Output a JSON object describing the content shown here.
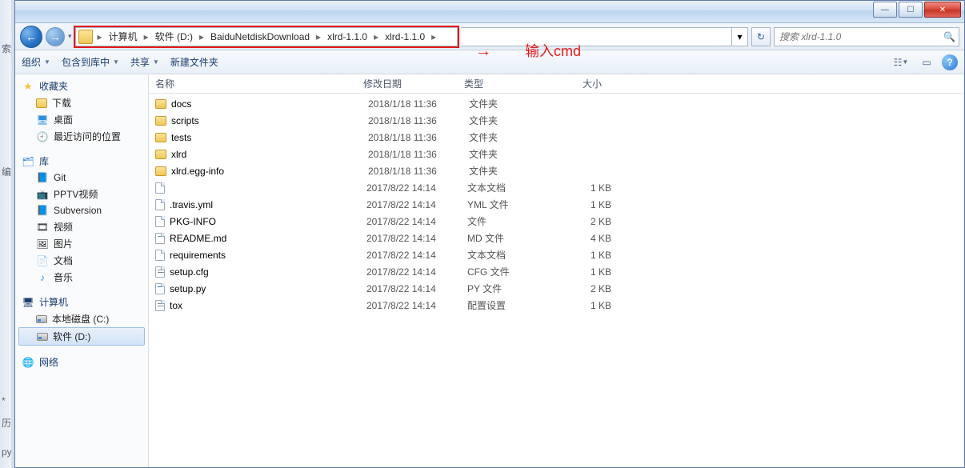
{
  "edge": {
    "t1": "索",
    "t2": "编",
    "t3": "*",
    "t4": "历",
    "t5": "py"
  },
  "titlebar": {
    "min": "—",
    "max": "☐",
    "close": "✕"
  },
  "nav": {
    "back": "←",
    "fwd": "→",
    "dropdown": "▾",
    "refresh": "↻"
  },
  "breadcrumb": {
    "items": [
      "计算机",
      "软件 (D:)",
      "BaiduNetdiskDownload",
      "xlrd-1.1.0",
      "xlrd-1.1.0"
    ],
    "sep": "▸"
  },
  "search": {
    "placeholder": "搜索 xlrd-1.1.0",
    "icon": "🔍"
  },
  "toolbar": {
    "organize": "组织",
    "include": "包含到库中",
    "share": "共享",
    "newfolder": "新建文件夹",
    "view_icon": "☷",
    "preview_icon": "▭",
    "arrow": "▼"
  },
  "sidebar": {
    "favorites": {
      "label": "收藏夹",
      "items": [
        {
          "icon": "download",
          "label": "下载"
        },
        {
          "icon": "desktop",
          "label": "桌面"
        },
        {
          "icon": "recent",
          "label": "最近访问的位置"
        }
      ]
    },
    "libraries": {
      "label": "库",
      "items": [
        {
          "icon": "git",
          "label": "Git"
        },
        {
          "icon": "pptv",
          "label": "PPTV视频"
        },
        {
          "icon": "svn",
          "label": "Subversion"
        },
        {
          "icon": "video",
          "label": "视频"
        },
        {
          "icon": "pic",
          "label": "图片"
        },
        {
          "icon": "doc",
          "label": "文档"
        },
        {
          "icon": "music",
          "label": "音乐"
        }
      ]
    },
    "computer": {
      "label": "计算机",
      "items": [
        {
          "icon": "drive-c",
          "label": "本地磁盘 (C:)"
        },
        {
          "icon": "drive-d",
          "label": "软件 (D:)",
          "selected": true
        }
      ]
    },
    "network": {
      "label": "网络"
    }
  },
  "columns": {
    "name": "名称",
    "date": "修改日期",
    "type": "类型",
    "size": "大小"
  },
  "files": [
    {
      "icon": "folder",
      "name": "docs",
      "date": "2018/1/18 11:36",
      "type": "文件夹",
      "size": ""
    },
    {
      "icon": "folder",
      "name": "scripts",
      "date": "2018/1/18 11:36",
      "type": "文件夹",
      "size": ""
    },
    {
      "icon": "folder",
      "name": "tests",
      "date": "2018/1/18 11:36",
      "type": "文件夹",
      "size": ""
    },
    {
      "icon": "folder",
      "name": "xlrd",
      "date": "2018/1/18 11:36",
      "type": "文件夹",
      "size": ""
    },
    {
      "icon": "folder",
      "name": "xlrd.egg-info",
      "date": "2018/1/18 11:36",
      "type": "文件夹",
      "size": ""
    },
    {
      "icon": "file",
      "name": "",
      "date": "2017/8/22 14:14",
      "type": "文本文档",
      "size": "1 KB"
    },
    {
      "icon": "file",
      "name": ".travis.yml",
      "date": "2017/8/22 14:14",
      "type": "YML 文件",
      "size": "1 KB"
    },
    {
      "icon": "file",
      "name": "PKG-INFO",
      "date": "2017/8/22 14:14",
      "type": "文件",
      "size": "2 KB"
    },
    {
      "icon": "md",
      "name": "README.md",
      "date": "2017/8/22 14:14",
      "type": "MD 文件",
      "size": "4 KB"
    },
    {
      "icon": "file",
      "name": "requirements",
      "date": "2017/8/22 14:14",
      "type": "文本文档",
      "size": "1 KB"
    },
    {
      "icon": "cfg",
      "name": "setup.cfg",
      "date": "2017/8/22 14:14",
      "type": "CFG 文件",
      "size": "1 KB"
    },
    {
      "icon": "py",
      "name": "setup.py",
      "date": "2017/8/22 14:14",
      "type": "PY 文件",
      "size": "2 KB"
    },
    {
      "icon": "cfg",
      "name": "tox",
      "date": "2017/8/22 14:14",
      "type": "配置设置",
      "size": "1 KB"
    }
  ],
  "annotation": {
    "arrow": "→",
    "text": "输入cmd"
  }
}
